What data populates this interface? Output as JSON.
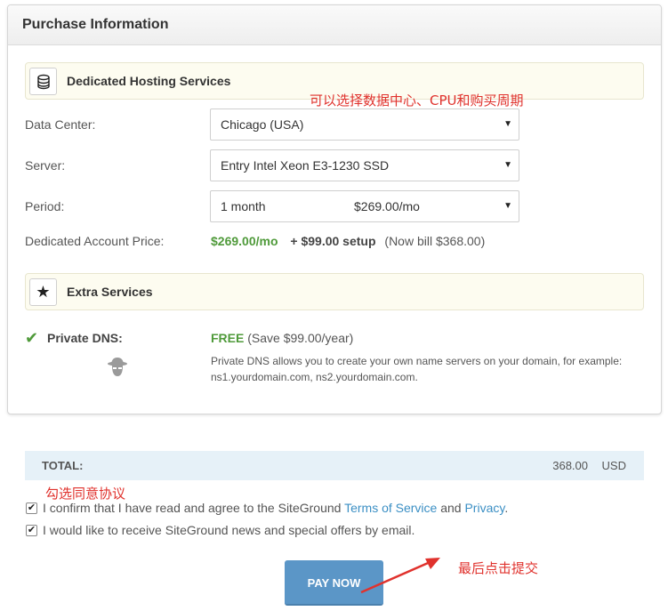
{
  "panel": {
    "title": "Purchase Information"
  },
  "hosting": {
    "section_title": "Dedicated Hosting Services",
    "icon": "database-icon",
    "data_center": {
      "label": "Data Center:",
      "value": "Chicago (USA)"
    },
    "server": {
      "label": "Server:",
      "value": "Entry Intel Xeon E3-1230 SSD"
    },
    "period": {
      "label": "Period:",
      "value": "1 month",
      "price": "$269.00/mo"
    },
    "price": {
      "label": "Dedicated Account Price:",
      "monthly": "$269.00/mo",
      "setup": "+ $99.00 setup",
      "bill": "(Now bill $368.00)"
    }
  },
  "extra": {
    "section_title": "Extra Services",
    "icon": "star-icon",
    "private_dns": {
      "label": "Private DNS:",
      "free": "FREE",
      "save": "(Save $99.00/year)",
      "description": "Private DNS allows you to create your own name servers on your domain, for example: ns1.yourdomain.com, ns2.yourdomain.com."
    }
  },
  "total": {
    "label": "TOTAL:",
    "amount": "368.00",
    "currency": "USD"
  },
  "agreements": {
    "tos_prefix": "I confirm that I have read and agree to the SiteGround",
    "tos_link": "Terms of Service",
    "and": "and",
    "privacy_link": "Privacy",
    "period": ".",
    "news": "I would like to receive SiteGround news and special offers by email.",
    "tos_checked": true,
    "news_checked": true
  },
  "pay_button": "PAY NOW",
  "annotations": {
    "choose": "可以选择数据中心、CPU和购买周期",
    "agree": "勾选同意协议",
    "submit": "最后点击提交"
  },
  "colors": {
    "accent_green": "#4f9a3a",
    "link_blue": "#3b8fc4",
    "button_blue": "#5b96c7",
    "annotation_red": "#e0322d"
  }
}
